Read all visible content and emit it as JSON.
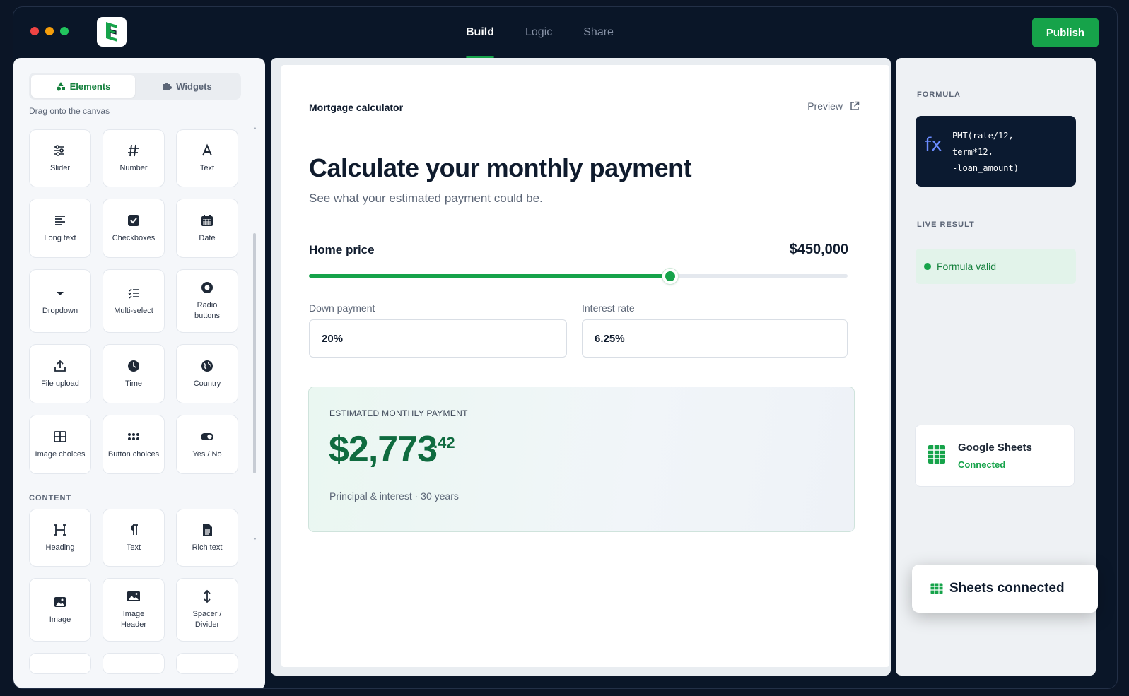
{
  "app": {
    "window_dots": [
      "#ef4444",
      "#f59e0b",
      "#22c55e"
    ],
    "accent_color": "#16a34a"
  },
  "topbar": {
    "tabs": [
      {
        "label": "Build",
        "active": true
      },
      {
        "label": "Logic",
        "active": false
      },
      {
        "label": "Share",
        "active": false
      }
    ],
    "publish_label": "Publish"
  },
  "sidebar": {
    "segments": [
      {
        "label": "Elements",
        "icon": "shapes-icon",
        "active": true
      },
      {
        "label": "Widgets",
        "icon": "puzzle-icon",
        "active": false
      }
    ],
    "hint": "Drag onto the canvas",
    "elements": [
      {
        "label": "Slider",
        "icon": "sliders-icon"
      },
      {
        "label": "Number",
        "icon": "hash-icon"
      },
      {
        "label": "Text",
        "icon": "letter-a-icon"
      },
      {
        "label": "Long text",
        "icon": "align-left-icon"
      },
      {
        "label": "Checkboxes",
        "icon": "checkbox-icon"
      },
      {
        "label": "Date",
        "icon": "calendar-icon"
      },
      {
        "label": "Dropdown",
        "icon": "caret-down-icon"
      },
      {
        "label": "Multi-select",
        "icon": "list-check-icon"
      },
      {
        "label": "Radio\nbuttons",
        "icon": "radio-icon"
      },
      {
        "label": "File upload",
        "icon": "upload-icon"
      },
      {
        "label": "Time",
        "icon": "clock-icon"
      },
      {
        "label": "Country",
        "icon": "globe-icon"
      },
      {
        "label": "Image choices",
        "icon": "grid-image-icon"
      },
      {
        "label": "Button choices",
        "icon": "dots-grid-icon"
      },
      {
        "label": "Yes / No",
        "icon": "toggle-icon"
      }
    ],
    "content_label": "CONTENT",
    "content": [
      {
        "label": "Heading",
        "icon": "heading-icon"
      },
      {
        "label": "Text",
        "icon": "pilcrow-icon"
      },
      {
        "label": "Rich text",
        "icon": "document-icon"
      },
      {
        "label": "Image",
        "icon": "image-icon"
      },
      {
        "label": "Image\nHeader",
        "icon": "image-header-icon"
      },
      {
        "label": "Spacer /\nDivider",
        "icon": "vertical-arrows-icon"
      }
    ]
  },
  "canvas": {
    "form_name": "Mortgage calculator",
    "preview_label": "Preview",
    "headline": "Calculate your monthly payment",
    "subhead": "See what your estimated payment could be.",
    "home_price": {
      "label": "Home price",
      "value": "$450,000",
      "slider_fraction": 0.67
    },
    "down_payment": {
      "label": "Down payment",
      "value": "20%"
    },
    "interest_rate": {
      "label": "Interest rate",
      "value": "6.25%"
    },
    "result": {
      "label": "ESTIMATED MONTHLY PAYMENT",
      "amount": "$2,773",
      "cents": ".42",
      "note": "Principal & interest · 30 years"
    }
  },
  "panel": {
    "formula_heading": "FORMULA",
    "fx": "fx",
    "formula": "PMT(rate/12,\nterm*12,\n-loan_amount)",
    "live_result_heading": "LIVE RESULT",
    "valid_label": "Formula valid",
    "integration": {
      "name": "Google Sheets",
      "status": "Connected"
    }
  },
  "toast": {
    "label": "Sheets connected"
  }
}
